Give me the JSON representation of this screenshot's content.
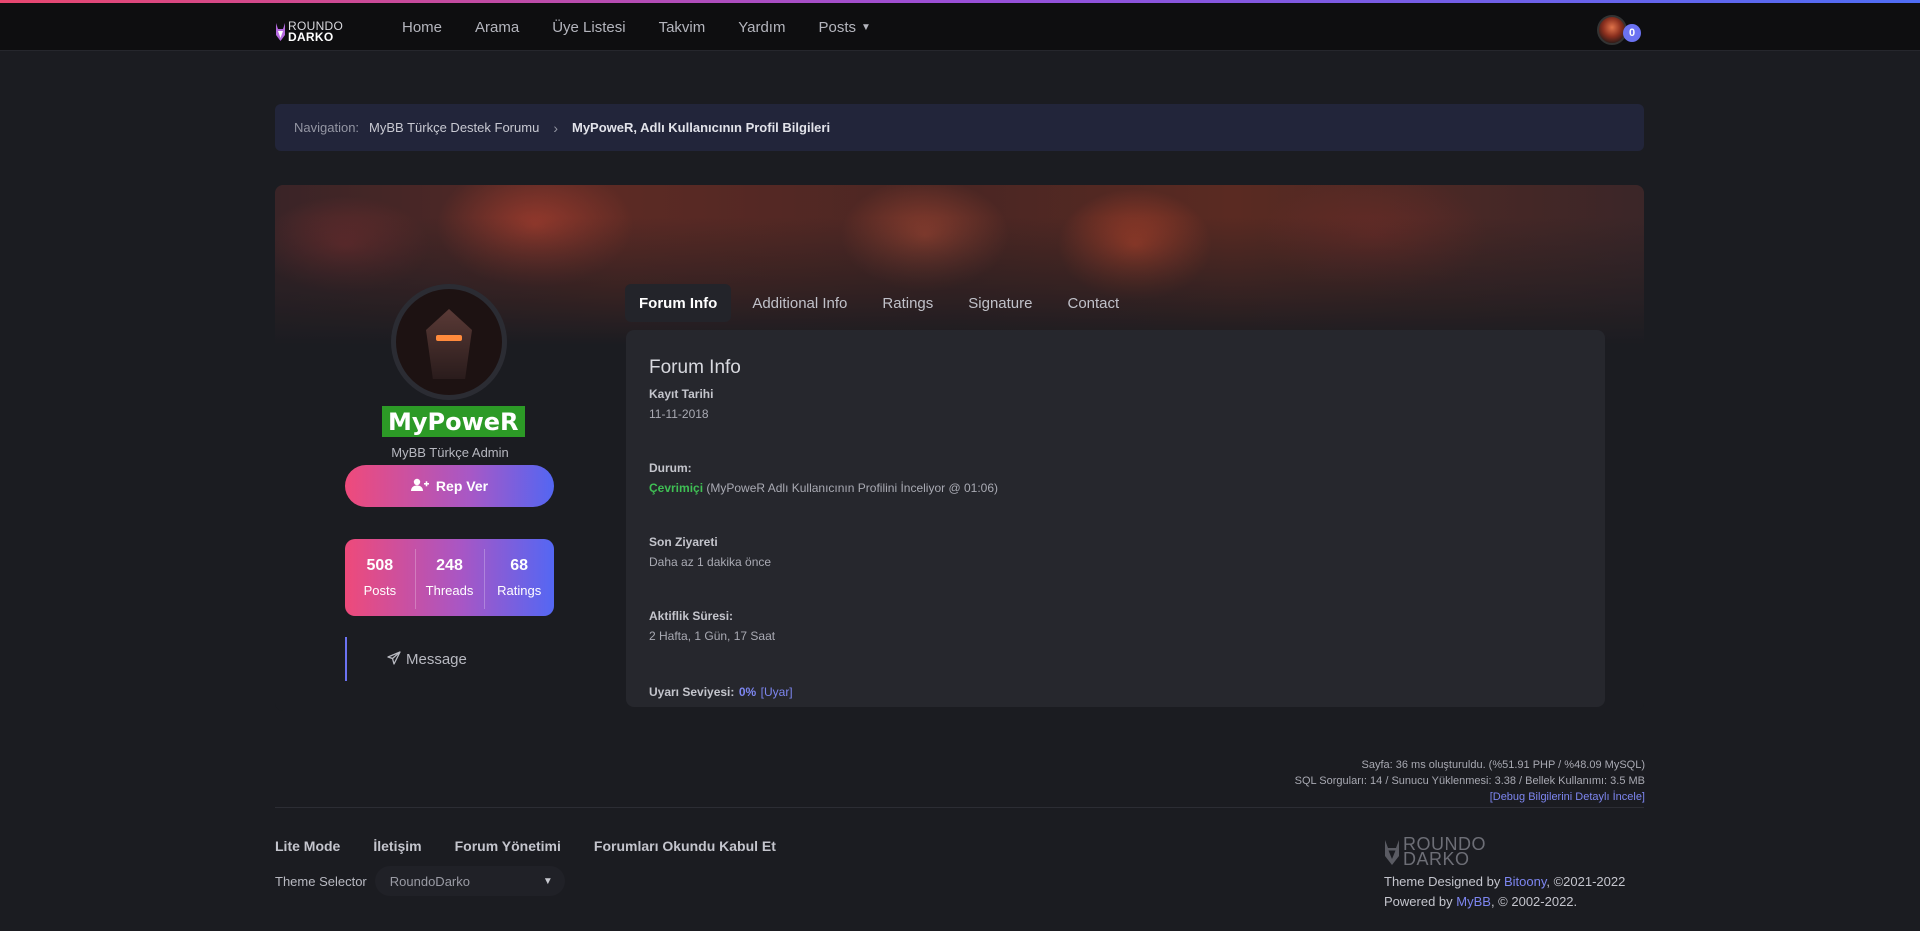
{
  "header": {
    "logo_line1": "ROUNDO",
    "logo_line2": "DARKO",
    "nav": [
      "Home",
      "Arama",
      "Üye Listesi",
      "Takvim",
      "Yardım",
      "Posts"
    ],
    "notification_count": "0"
  },
  "breadcrumb": {
    "label": "Navigation:",
    "items": [
      "MyBB Türkçe Destek Forumu"
    ],
    "separator": "›",
    "current": "MyPoweR, Adlı Kullanıcının Profil Bilgileri"
  },
  "profile": {
    "username": "MyPoweR",
    "user_title": "MyBB Türkçe Admin",
    "rep_button": "Rep Ver",
    "stats": [
      {
        "value": "508",
        "label": "Posts"
      },
      {
        "value": "248",
        "label": "Threads"
      },
      {
        "value": "68",
        "label": "Ratings"
      }
    ],
    "message_label": "Message",
    "username_color": "#2c9a26"
  },
  "tabs": [
    "Forum Info",
    "Additional Info",
    "Ratings",
    "Signature",
    "Contact"
  ],
  "forum_info": {
    "title": "Forum Info",
    "kayit_label": "Kayıt Tarihi",
    "kayit_value": "11-11-2018",
    "durum_label": "Durum:",
    "durum_status": "Çevrimiçi",
    "durum_detail": "(MyPoweR Adlı Kullanıcının Profilini İnceliyor @ 01:06)",
    "son_label": "Son Ziyareti",
    "son_value": "Daha az 1 dakika önce",
    "aktif_label": "Aktiflik Süresi:",
    "aktif_value": "2 Hafta, 1 Gün, 17 Saat",
    "uyari_label": "Uyarı Seviyesi:",
    "uyari_value": "0%",
    "uyari_link": "[Uyar]"
  },
  "debug": {
    "line1": "Sayfa: 36 ms oluşturuldu. (%51.91 PHP / %48.09 MySQL)",
    "line2": "SQL Sorguları: 14 / Sunucu Yüklenmesi: 3.38 / Bellek Kullanımı: 3.5 MB",
    "link": "[Debug Bilgilerini Detaylı İncele]"
  },
  "footer": {
    "links": [
      "Lite Mode",
      "İletişim",
      "Forum Yönetimi",
      "Forumları Okundu Kabul Et"
    ],
    "theme_label": "Theme Selector",
    "theme_value": "RoundoDarko",
    "logo_line1": "ROUNDO",
    "logo_line2": "DARKO",
    "designed_prefix": "Theme Designed by",
    "designed_by": "Bitoony",
    "designed_suffix": ", ©2021-2022",
    "powered_prefix": "Powered by",
    "powered_by": "MyBB",
    "powered_suffix": ", © 2002-2022."
  },
  "colors": {
    "accent_pink": "#ef4a7b",
    "accent_blue": "#5366f2",
    "online_green": "#3fbf54",
    "link_blue": "#7d86f0"
  }
}
